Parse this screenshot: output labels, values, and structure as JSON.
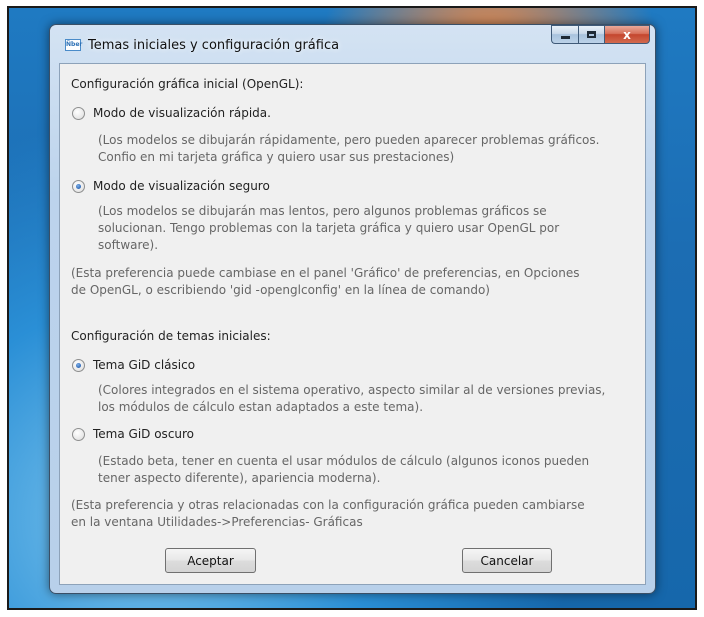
{
  "window": {
    "title": "Temas iniciales y configuración gráfica",
    "icon_text": "Ñber",
    "close_glyph": "x"
  },
  "opengl": {
    "heading": "Configuración gráfica inicial (OpenGL):",
    "options": [
      {
        "label": "Modo de visualización rápida.",
        "checked": false,
        "desc": [
          "(Los modelos se dibujarán rápidamente, pero pueden aparecer problemas gráficos.",
          "Confio en mi tarjeta gráfica y quiero usar sus prestaciones)"
        ]
      },
      {
        "label": "Modo de visualización seguro",
        "checked": true,
        "desc": [
          "(Los modelos se dibujarán mas lentos, pero algunos problemas gráficos se",
          "solucionan. Tengo problemas con la tarjeta gráfica y quiero usar OpenGL por",
          "software)."
        ]
      }
    ],
    "note": [
      "(Esta preferencia puede cambiase en el panel 'Gráfico' de preferencias, en Opciones",
      "de OpenGL, o escribiendo 'gid -openglconfig' en la línea de comando)"
    ]
  },
  "themes": {
    "heading": "Configuración de temas iniciales:",
    "options": [
      {
        "label": "Tema GiD clásico",
        "checked": true,
        "desc": [
          "(Colores integrados en el sistema operativo, aspecto similar al de versiones previas,",
          "los módulos de cálculo estan adaptados a este tema)."
        ]
      },
      {
        "label": "Tema GiD oscuro",
        "checked": false,
        "desc": [
          "(Estado beta, tener en cuenta el usar módulos de cálculo (algunos iconos pueden",
          "tener aspecto diferente), apariencia moderna)."
        ]
      }
    ],
    "note": [
      "(Esta preferencia y otras relacionadas con la configuración gráfica pueden cambiarse",
      "en la ventana Utilidades->Preferencias- Gráficas"
    ]
  },
  "buttons": {
    "accept": "Aceptar",
    "cancel": "Cancelar"
  },
  "colors": {
    "accent": "#2e67b6",
    "desc_text": "#666666"
  }
}
